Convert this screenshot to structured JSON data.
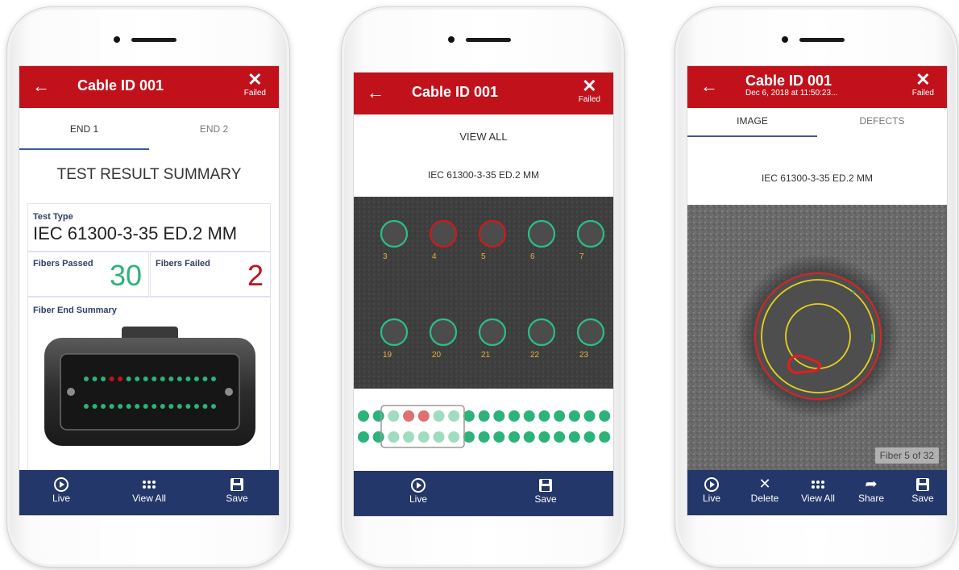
{
  "colors": {
    "header_red": "#c1121c",
    "nav_blue": "#24376a",
    "pass_green": "#2bb37a",
    "fail_red": "#c1121c",
    "tab_underline": "#3a5a96"
  },
  "screen1": {
    "title": "Cable ID 001",
    "status": "Failed",
    "tabs": [
      "END 1",
      "END 2"
    ],
    "heading": "TEST RESULT SUMMARY",
    "test_type_label": "Test Type",
    "test_type_value": "IEC 61300-3-35 ED.2 MM",
    "fibers_passed_label": "Fibers Passed",
    "fibers_passed_value": "30",
    "fibers_failed_label": "Fibers Failed",
    "fibers_failed_value": "2",
    "fiber_end_summary_label": "Fiber End Summary",
    "connector_row1_status": [
      "pass",
      "pass",
      "pass",
      "fail",
      "fail",
      "pass",
      "pass",
      "pass",
      "pass",
      "pass",
      "pass",
      "pass",
      "pass",
      "pass",
      "pass",
      "pass"
    ],
    "connector_row2_status": [
      "pass",
      "pass",
      "pass",
      "pass",
      "pass",
      "pass",
      "pass",
      "pass",
      "pass",
      "pass",
      "pass",
      "pass",
      "pass",
      "pass",
      "pass",
      "pass"
    ],
    "bottom_nav": [
      "Live",
      "View All",
      "Save"
    ]
  },
  "screen2": {
    "title": "Cable ID 001",
    "status": "Failed",
    "view_all": "VIEW ALL",
    "standard": "IEC 61300-3-35 ED.2 MM",
    "fibers_top": [
      {
        "label": "3",
        "state": "pass"
      },
      {
        "label": "4",
        "state": "fail"
      },
      {
        "label": "5",
        "state": "fail"
      },
      {
        "label": "6",
        "state": "pass"
      },
      {
        "label": "7",
        "state": "pass"
      }
    ],
    "fibers_bottom": [
      {
        "label": "19",
        "state": "pass"
      },
      {
        "label": "20",
        "state": "pass"
      },
      {
        "label": "21",
        "state": "pass"
      },
      {
        "label": "22",
        "state": "pass"
      },
      {
        "label": "23",
        "state": "pass"
      }
    ],
    "map_row1": [
      "pass",
      "pass",
      "pass",
      "fail",
      "fail",
      "pass",
      "pass",
      "pass",
      "pass",
      "pass",
      "pass",
      "pass",
      "pass",
      "pass",
      "pass",
      "pass",
      "pass"
    ],
    "map_row2": [
      "pass",
      "pass",
      "pass",
      "pass",
      "pass",
      "pass",
      "pass",
      "pass",
      "pass",
      "pass",
      "pass",
      "pass",
      "pass",
      "pass",
      "pass",
      "pass",
      "pass"
    ],
    "bottom_nav": [
      "Live",
      "Save"
    ]
  },
  "screen3": {
    "title": "Cable ID 001",
    "subtitle": "Dec 6, 2018 at 11:50:23...",
    "status": "Failed",
    "tabs": [
      "IMAGE",
      "DEFECTS"
    ],
    "standard": "IEC 61300-3-35 ED.2 MM",
    "fiber_badge": "Fiber 5 of 32",
    "bottom_nav": [
      "Live",
      "Delete",
      "View All",
      "Share",
      "Save"
    ]
  }
}
